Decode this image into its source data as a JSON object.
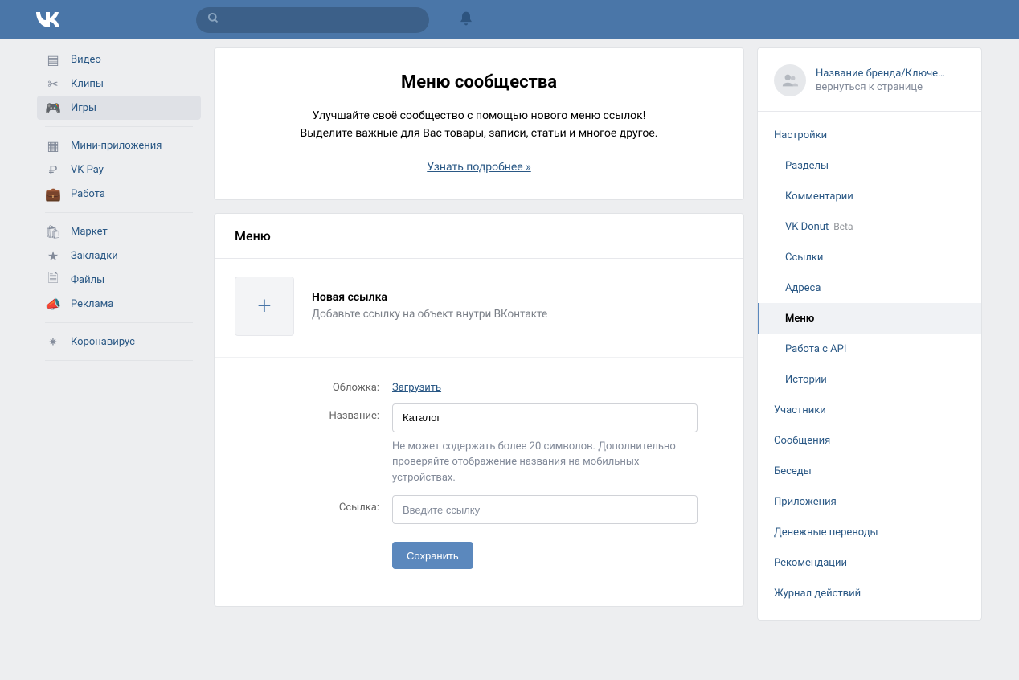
{
  "leftNav": [
    {
      "icon": "film",
      "label": "Видео"
    },
    {
      "icon": "clips",
      "label": "Клипы"
    },
    {
      "icon": "gamepad",
      "label": "Игры",
      "active": true
    },
    {
      "sep": true
    },
    {
      "icon": "apps",
      "label": "Мини-приложения"
    },
    {
      "icon": "pay",
      "label": "VK Pay"
    },
    {
      "icon": "work",
      "label": "Работа"
    },
    {
      "sep": true
    },
    {
      "icon": "market",
      "label": "Маркет"
    },
    {
      "icon": "star",
      "label": "Закладки"
    },
    {
      "icon": "file",
      "label": "Файлы"
    },
    {
      "icon": "ads",
      "label": "Реклама"
    },
    {
      "sep": true
    },
    {
      "icon": "virus",
      "label": "Коронавирус"
    },
    {
      "sep": true
    }
  ],
  "banner": {
    "title": "Меню сообщества",
    "line1": "Улучшайте своё сообщество с помощью нового меню ссылок!",
    "line2": "Выделите важные для Вас товары, записи, статьи и многое другое.",
    "more": "Узнать подробнее »"
  },
  "menuCard": {
    "header": "Меню",
    "newLinkTitle": "Новая ссылка",
    "newLinkSub": "Добавьте ссылку на объект внутри ВКонтакте"
  },
  "form": {
    "coverLabel": "Обложка:",
    "coverAction": "Загрузить",
    "nameLabel": "Название:",
    "nameValue": "Каталог",
    "nameHelp": "Не может содержать более 20 символов. Дополнительно проверяйте отображение названия на мобильных устройствах.",
    "linkLabel": "Ссылка:",
    "linkPlaceholder": "Введите ссылку",
    "save": "Сохранить"
  },
  "right": {
    "profileTitle": "Название бренда/Ключе…",
    "profileSub": "вернуться к странице",
    "settingsLabel": "Настройки",
    "settingsSub": [
      {
        "label": "Разделы"
      },
      {
        "label": "Комментарии"
      },
      {
        "label": "VK Donut",
        "badge": "Beta"
      },
      {
        "label": "Ссылки"
      },
      {
        "label": "Адреса"
      },
      {
        "label": "Меню",
        "active": true
      },
      {
        "label": "Работа с API"
      },
      {
        "label": "Истории"
      }
    ],
    "tail": [
      "Участники",
      "Сообщения",
      "Беседы",
      "Приложения",
      "Денежные переводы",
      "Рекомендации",
      "Журнал действий"
    ]
  }
}
